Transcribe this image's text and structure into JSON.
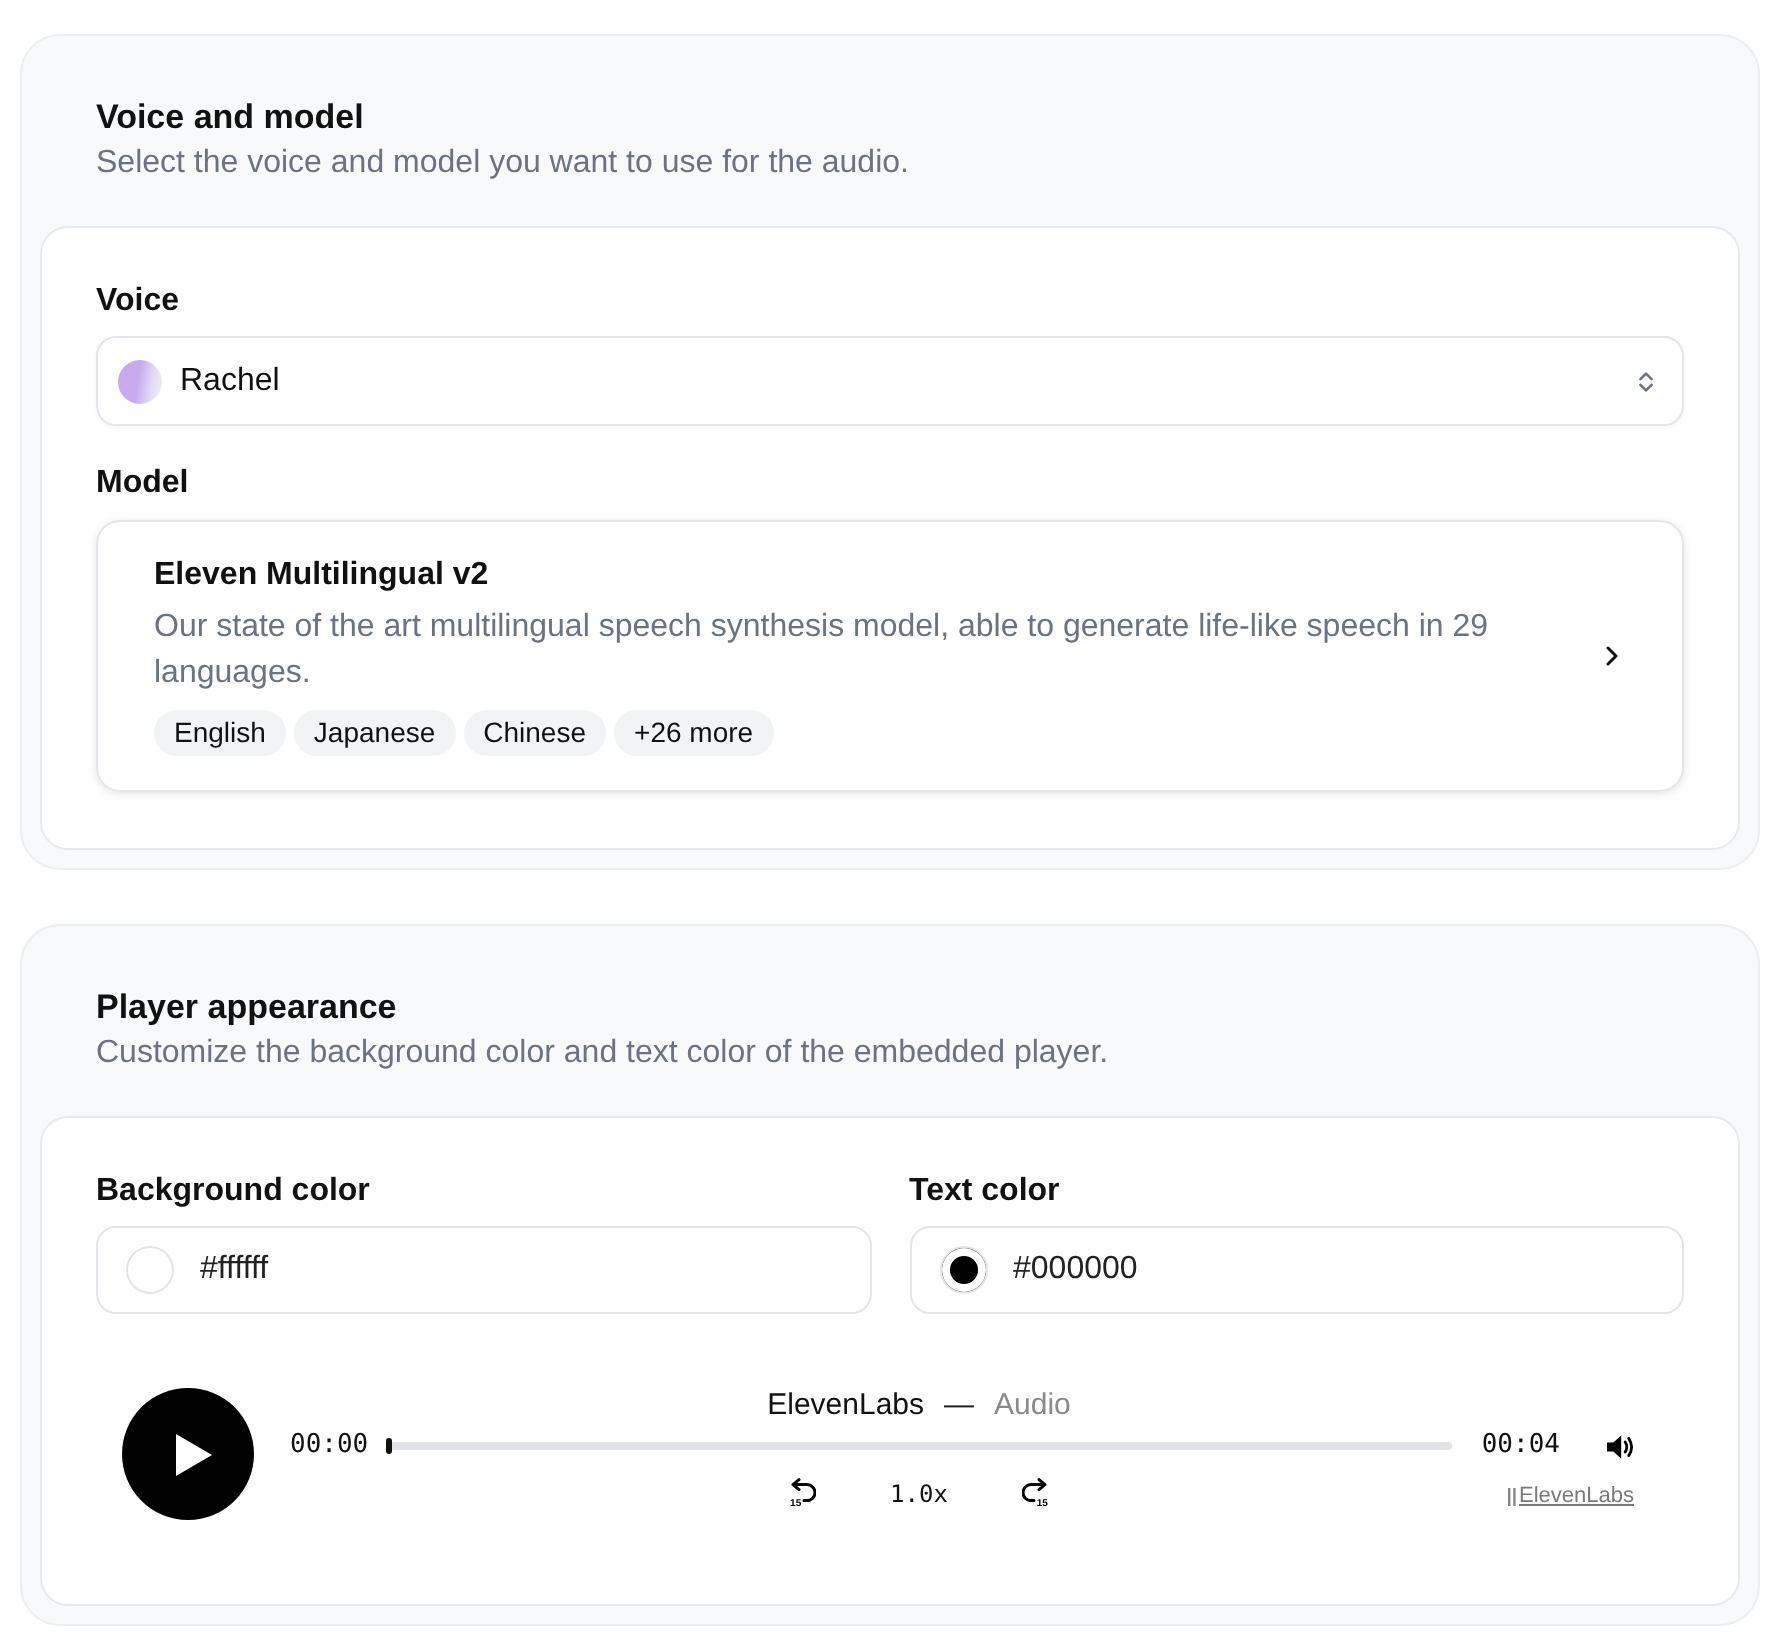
{
  "voice_and_model": {
    "title": "Voice and model",
    "subtitle": "Select the voice and model you want to use for the audio.",
    "voice": {
      "label": "Voice",
      "value": "Rachel"
    },
    "model": {
      "label": "Model",
      "name": "Eleven Multilingual v2",
      "description": "Our state of the art multilingual speech synthesis model, able to generate life-like speech in 29 languages.",
      "languages": [
        "English",
        "Japanese",
        "Chinese",
        "+26 more"
      ]
    }
  },
  "player_appearance": {
    "title": "Player appearance",
    "subtitle": "Customize the background color and text color of the embedded player.",
    "color_fields": [
      {
        "label": "Background color",
        "value": "#ffffff",
        "color": "#ffffff"
      },
      {
        "label": "Text color",
        "value": "#000000",
        "color": "#000000"
      }
    ],
    "player": {
      "title": "ElevenLabs",
      "separator": "—",
      "subtitle": "Audio",
      "current_time": "00:00",
      "duration": "00:04",
      "level": 0,
      "skip_back": "15",
      "speed": "1.0x",
      "skip_forward": "15",
      "branding": "ElevenLabs"
    }
  }
}
